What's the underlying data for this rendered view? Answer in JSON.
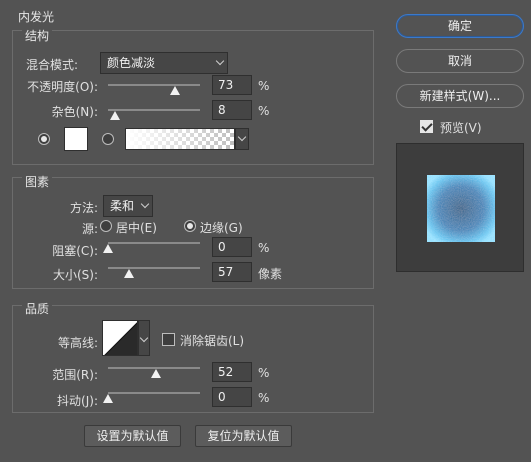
{
  "panel": {
    "title": "内发光",
    "structure": {
      "title": "结构",
      "blend_mode_label": "混合模式:",
      "blend_mode_value": "颜色减淡",
      "opacity_label": "不透明度(O):",
      "opacity_value": "73",
      "opacity_percent": 73,
      "opacity_unit": "%",
      "noise_label": "杂色(N):",
      "noise_value": "8",
      "noise_percent": 8,
      "noise_unit": "%",
      "color_mode": "solid",
      "glow_color": "#ffffff"
    },
    "elements": {
      "title": "图素",
      "technique_label": "方法:",
      "technique_value": "柔和",
      "source_label": "源:",
      "source_center_label": "居中(E)",
      "source_edge_label": "边缘(G)",
      "source_selected": "edge",
      "choke_label": "阻塞(C):",
      "choke_value": "0",
      "choke_percent": 0,
      "choke_unit": "%",
      "size_label": "大小(S):",
      "size_value": "57",
      "size_fraction": 0.23,
      "size_unit": "像素"
    },
    "quality": {
      "title": "品质",
      "contour_label": "等高线:",
      "antialias_label": "消除锯齿(L)",
      "antialias_checked": false,
      "range_label": "范围(R):",
      "range_value": "52",
      "range_percent": 52,
      "range_unit": "%",
      "jitter_label": "抖动(J):",
      "jitter_value": "0",
      "jitter_percent": 0,
      "jitter_unit": "%"
    },
    "make_default_label": "设置为默认值",
    "reset_default_label": "复位为默认值"
  },
  "side": {
    "ok_label": "确定",
    "cancel_label": "取消",
    "new_style_label": "新建样式(W)...",
    "preview_label": "预览(V)",
    "preview_checked": true,
    "preview_glow_color": "#4fb6e8"
  }
}
